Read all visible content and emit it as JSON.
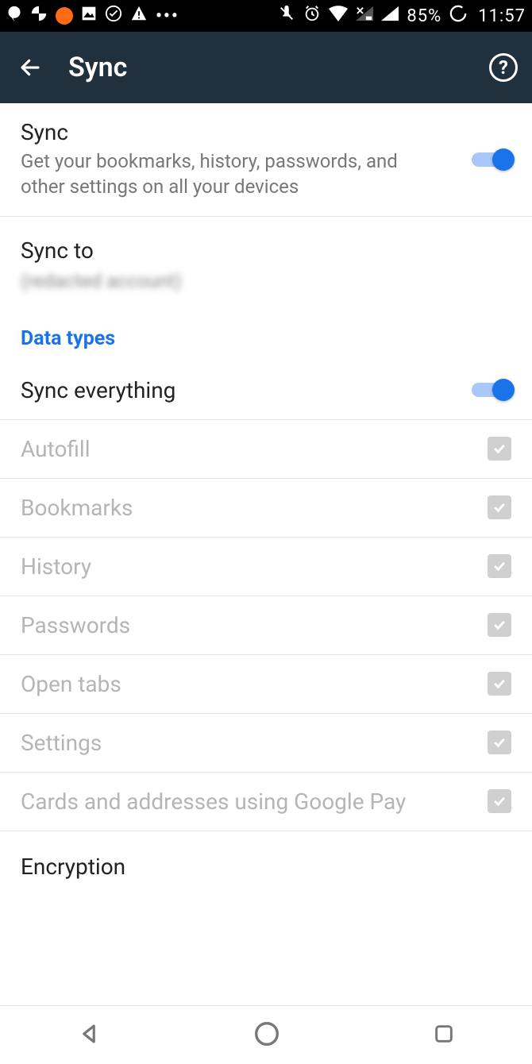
{
  "status": {
    "battery": "85%",
    "time": "11:57"
  },
  "appbar": {
    "title": "Sync"
  },
  "sync_main": {
    "title": "Sync",
    "subtitle": "Get your bookmarks, history, passwords, and other settings on all your devices",
    "on": true
  },
  "sync_to": {
    "title": "Sync to",
    "account": "(redacted account)"
  },
  "section_header": "Data types",
  "sync_everything": {
    "label": "Sync everything",
    "on": true
  },
  "types": [
    {
      "label": "Autofill"
    },
    {
      "label": "Bookmarks"
    },
    {
      "label": "History"
    },
    {
      "label": "Passwords"
    },
    {
      "label": "Open tabs"
    },
    {
      "label": "Settings"
    },
    {
      "label": "Cards and addresses using Google Pay"
    }
  ],
  "encryption": {
    "label": "Encryption"
  }
}
